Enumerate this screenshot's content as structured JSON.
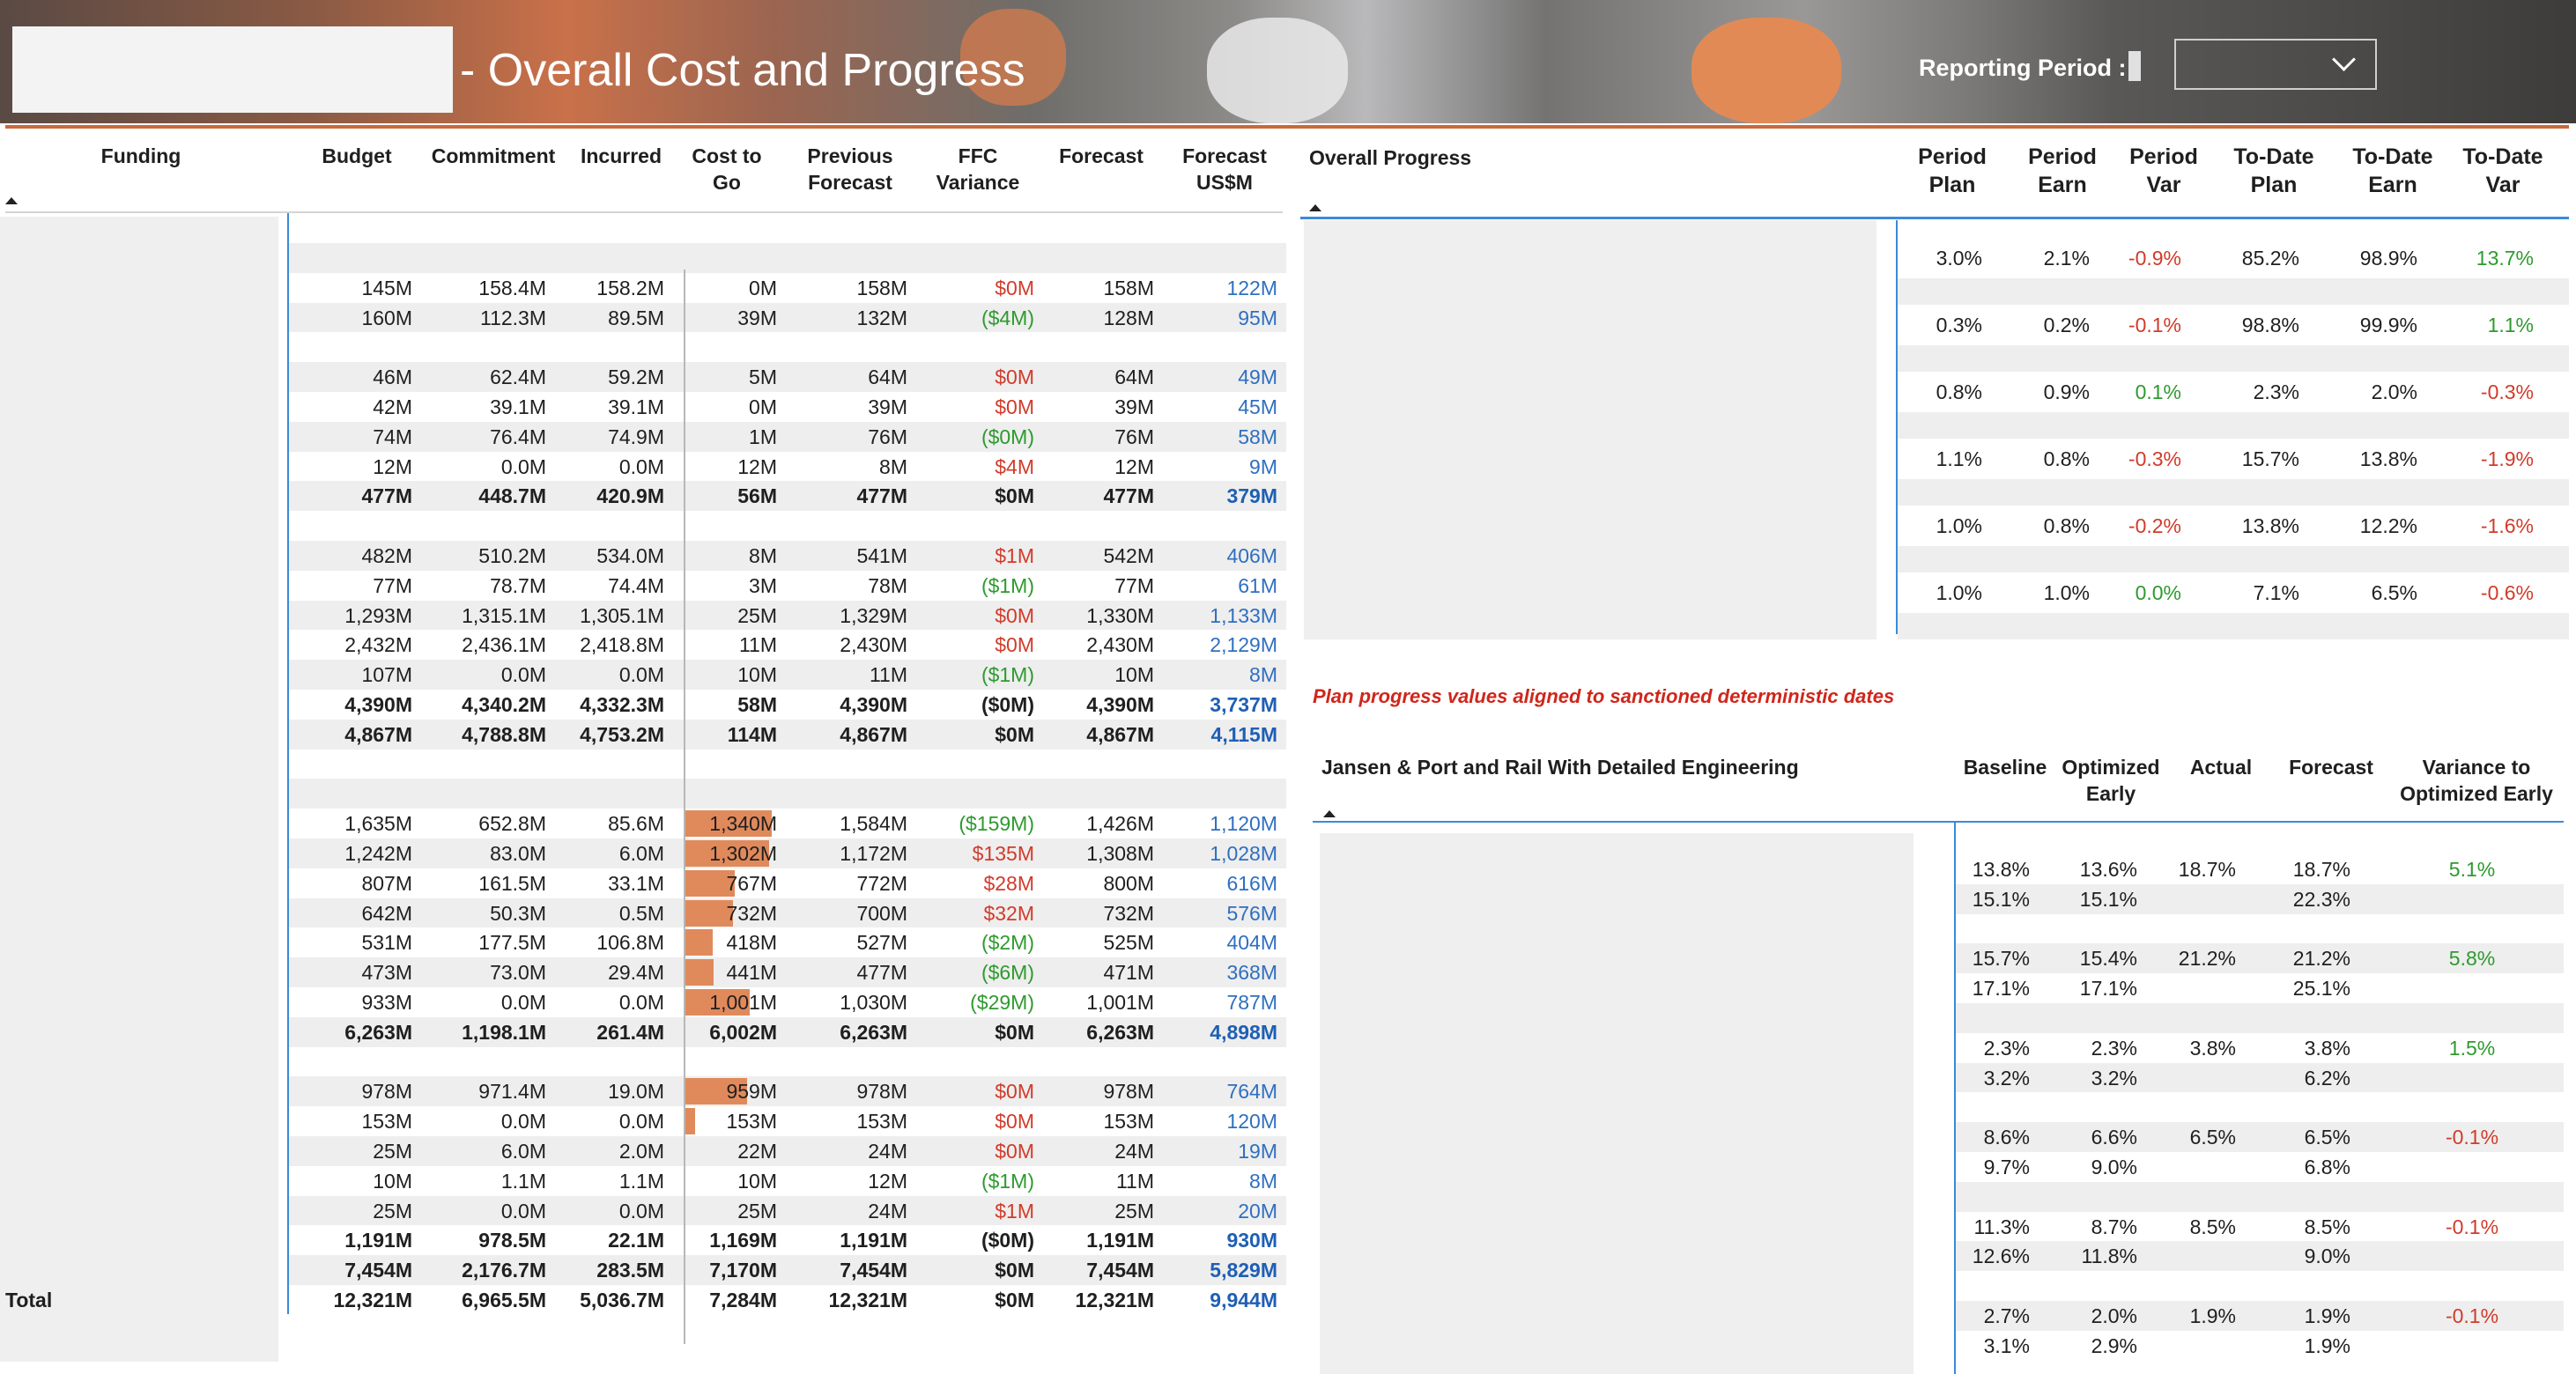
{
  "header": {
    "title": "- Overall Cost and Progress",
    "reporting_period_label": "Reporting Period :"
  },
  "cost_table": {
    "columns": [
      "Funding",
      "Budget",
      "Commitment",
      "Incurred",
      "Cost to Go",
      "Previous Forecast",
      "FFC Variance",
      "Forecast",
      "Forecast US$M"
    ],
    "rows": [
      {
        "type": "section"
      },
      {
        "cells": [
          "145M",
          "158.4M",
          "158.2M",
          "0M",
          "158M",
          "$0M",
          "158M",
          "122M"
        ],
        "var": "red",
        "ctg": 0
      },
      {
        "cells": [
          "160M",
          "112.3M",
          "89.5M",
          "39M",
          "132M",
          "($4M)",
          "128M",
          "95M"
        ],
        "var": "grn",
        "ctg": 0
      },
      {
        "type": "section"
      },
      {
        "cells": [
          "46M",
          "62.4M",
          "59.2M",
          "5M",
          "64M",
          "$0M",
          "64M",
          "49M"
        ],
        "var": "red",
        "ctg": 0
      },
      {
        "cells": [
          "42M",
          "39.1M",
          "39.1M",
          "0M",
          "39M",
          "$0M",
          "39M",
          "45M"
        ],
        "var": "red",
        "ctg": 0
      },
      {
        "cells": [
          "74M",
          "76.4M",
          "74.9M",
          "1M",
          "76M",
          "($0M)",
          "76M",
          "58M"
        ],
        "var": "grn",
        "ctg": 0
      },
      {
        "cells": [
          "12M",
          "0.0M",
          "0.0M",
          "12M",
          "8M",
          "$4M",
          "12M",
          "9M"
        ],
        "var": "red",
        "ctg": 0
      },
      {
        "cells": [
          "477M",
          "448.7M",
          "420.9M",
          "56M",
          "477M",
          "$0M",
          "477M",
          "379M"
        ],
        "bold": true
      },
      {
        "type": "section"
      },
      {
        "cells": [
          "482M",
          "510.2M",
          "534.0M",
          "8M",
          "541M",
          "$1M",
          "542M",
          "406M"
        ],
        "var": "red",
        "ctg": 0
      },
      {
        "cells": [
          "77M",
          "78.7M",
          "74.4M",
          "3M",
          "78M",
          "($1M)",
          "77M",
          "61M"
        ],
        "var": "grn",
        "ctg": 0
      },
      {
        "cells": [
          "1,293M",
          "1,315.1M",
          "1,305.1M",
          "25M",
          "1,329M",
          "$0M",
          "1,330M",
          "1,133M"
        ],
        "var": "red",
        "ctg": 0
      },
      {
        "cells": [
          "2,432M",
          "2,436.1M",
          "2,418.8M",
          "11M",
          "2,430M",
          "$0M",
          "2,430M",
          "2,129M"
        ],
        "var": "red",
        "ctg": 0
      },
      {
        "cells": [
          "107M",
          "0.0M",
          "0.0M",
          "10M",
          "11M",
          "($1M)",
          "10M",
          "8M"
        ],
        "var": "grn",
        "ctg": 0
      },
      {
        "cells": [
          "4,390M",
          "4,340.2M",
          "4,332.3M",
          "58M",
          "4,390M",
          "($0M)",
          "4,390M",
          "3,737M"
        ],
        "bold": true
      },
      {
        "cells": [
          "4,867M",
          "4,788.8M",
          "4,753.2M",
          "114M",
          "4,867M",
          "$0M",
          "4,867M",
          "4,115M"
        ],
        "bold": true
      },
      {
        "type": "section"
      },
      {
        "type": "section"
      },
      {
        "cells": [
          "1,635M",
          "652.8M",
          "85.6M",
          "1,340M",
          "1,584M",
          "($159M)",
          "1,426M",
          "1,120M"
        ],
        "var": "grn",
        "ctg": 1340
      },
      {
        "cells": [
          "1,242M",
          "83.0M",
          "6.0M",
          "1,302M",
          "1,172M",
          "$135M",
          "1,308M",
          "1,028M"
        ],
        "var": "red",
        "ctg": 1302
      },
      {
        "cells": [
          "807M",
          "161.5M",
          "33.1M",
          "767M",
          "772M",
          "$28M",
          "800M",
          "616M"
        ],
        "var": "red",
        "ctg": 767
      },
      {
        "cells": [
          "642M",
          "50.3M",
          "0.5M",
          "732M",
          "700M",
          "$32M",
          "732M",
          "576M"
        ],
        "var": "red",
        "ctg": 732
      },
      {
        "cells": [
          "531M",
          "177.5M",
          "106.8M",
          "418M",
          "527M",
          "($2M)",
          "525M",
          "404M"
        ],
        "var": "grn",
        "ctg": 418
      },
      {
        "cells": [
          "473M",
          "73.0M",
          "29.4M",
          "441M",
          "477M",
          "($6M)",
          "471M",
          "368M"
        ],
        "var": "grn",
        "ctg": 441
      },
      {
        "cells": [
          "933M",
          "0.0M",
          "0.0M",
          "1,001M",
          "1,030M",
          "($29M)",
          "1,001M",
          "787M"
        ],
        "var": "grn",
        "ctg": 1001
      },
      {
        "cells": [
          "6,263M",
          "1,198.1M",
          "261.4M",
          "6,002M",
          "6,263M",
          "$0M",
          "6,263M",
          "4,898M"
        ],
        "bold": true
      },
      {
        "type": "section"
      },
      {
        "cells": [
          "978M",
          "971.4M",
          "19.0M",
          "959M",
          "978M",
          "$0M",
          "978M",
          "764M"
        ],
        "var": "red",
        "ctg": 959
      },
      {
        "cells": [
          "153M",
          "0.0M",
          "0.0M",
          "153M",
          "153M",
          "$0M",
          "153M",
          "120M"
        ],
        "var": "red",
        "ctg": 153
      },
      {
        "cells": [
          "25M",
          "6.0M",
          "2.0M",
          "22M",
          "24M",
          "$0M",
          "24M",
          "19M"
        ],
        "var": "red",
        "ctg": 0
      },
      {
        "cells": [
          "10M",
          "1.1M",
          "1.1M",
          "10M",
          "12M",
          "($1M)",
          "11M",
          "8M"
        ],
        "var": "grn",
        "ctg": 0
      },
      {
        "cells": [
          "25M",
          "0.0M",
          "0.0M",
          "25M",
          "24M",
          "$1M",
          "25M",
          "20M"
        ],
        "var": "red",
        "ctg": 0
      },
      {
        "cells": [
          "1,191M",
          "978.5M",
          "22.1M",
          "1,169M",
          "1,191M",
          "($0M)",
          "1,191M",
          "930M"
        ],
        "bold": true
      },
      {
        "cells": [
          "7,454M",
          "2,176.7M",
          "283.5M",
          "7,170M",
          "7,454M",
          "$0M",
          "7,454M",
          "5,829M"
        ],
        "bold": true
      },
      {
        "label": "Total",
        "cells": [
          "12,321M",
          "6,965.5M",
          "5,036.7M",
          "7,284M",
          "12,321M",
          "$0M",
          "12,321M",
          "9,944M"
        ],
        "bold": true,
        "total": true
      }
    ]
  },
  "progress_table": {
    "title": "Overall Progress",
    "columns": [
      "Period Plan",
      "Period Earn",
      "Period Var",
      "To-Date Plan",
      "To-Date Earn",
      "To-Date Var"
    ],
    "rows": [
      [
        "3.0%",
        "2.1%",
        "-0.9%",
        "85.2%",
        "98.9%",
        "13.7%"
      ],
      [
        "0.3%",
        "0.2%",
        "-0.1%",
        "98.8%",
        "99.9%",
        "1.1%"
      ],
      [
        "0.8%",
        "0.9%",
        "0.1%",
        "2.3%",
        "2.0%",
        "-0.3%"
      ],
      [
        "1.1%",
        "0.8%",
        "-0.3%",
        "15.7%",
        "13.8%",
        "-1.9%"
      ],
      [
        "1.0%",
        "0.8%",
        "-0.2%",
        "13.8%",
        "12.2%",
        "-1.6%"
      ],
      [
        "1.0%",
        "1.0%",
        "0.0%",
        "7.1%",
        "6.5%",
        "-0.6%"
      ]
    ],
    "note": "Plan progress values aligned to sanctioned deterministic dates"
  },
  "jansen_table": {
    "title": "Jansen & Port and Rail With Detailed Engineering",
    "columns": [
      "Baseline",
      "Optimized Early",
      "Actual",
      "Forecast",
      "Variance to Optimized Early"
    ],
    "rows": [
      [
        "13.8%",
        "13.6%",
        "18.7%",
        "18.7%",
        "5.1%"
      ],
      [
        "15.1%",
        "15.1%",
        "",
        "22.3%",
        ""
      ],
      null,
      [
        "15.7%",
        "15.4%",
        "21.2%",
        "21.2%",
        "5.8%"
      ],
      [
        "17.1%",
        "17.1%",
        "",
        "25.1%",
        ""
      ],
      null,
      [
        "2.3%",
        "2.3%",
        "3.8%",
        "3.8%",
        "1.5%"
      ],
      [
        "3.2%",
        "3.2%",
        "",
        "6.2%",
        ""
      ],
      null,
      [
        "8.6%",
        "6.6%",
        "6.5%",
        "6.5%",
        "-0.1%"
      ],
      [
        "9.7%",
        "9.0%",
        "",
        "6.8%",
        ""
      ],
      null,
      [
        "11.3%",
        "8.7%",
        "8.5%",
        "8.5%",
        "-0.1%"
      ],
      [
        "12.6%",
        "11.8%",
        "",
        "9.0%",
        ""
      ],
      null,
      [
        "2.7%",
        "2.0%",
        "1.9%",
        "1.9%",
        "-0.1%"
      ],
      [
        "3.1%",
        "2.9%",
        "",
        "1.9%",
        ""
      ]
    ]
  },
  "colors": {
    "accent_orange": "#c8693c",
    "negative": "#d13b2a",
    "positive": "#2e9a2e",
    "forecast_blue": "#2f6fc0",
    "bar": "#e08a5c"
  }
}
